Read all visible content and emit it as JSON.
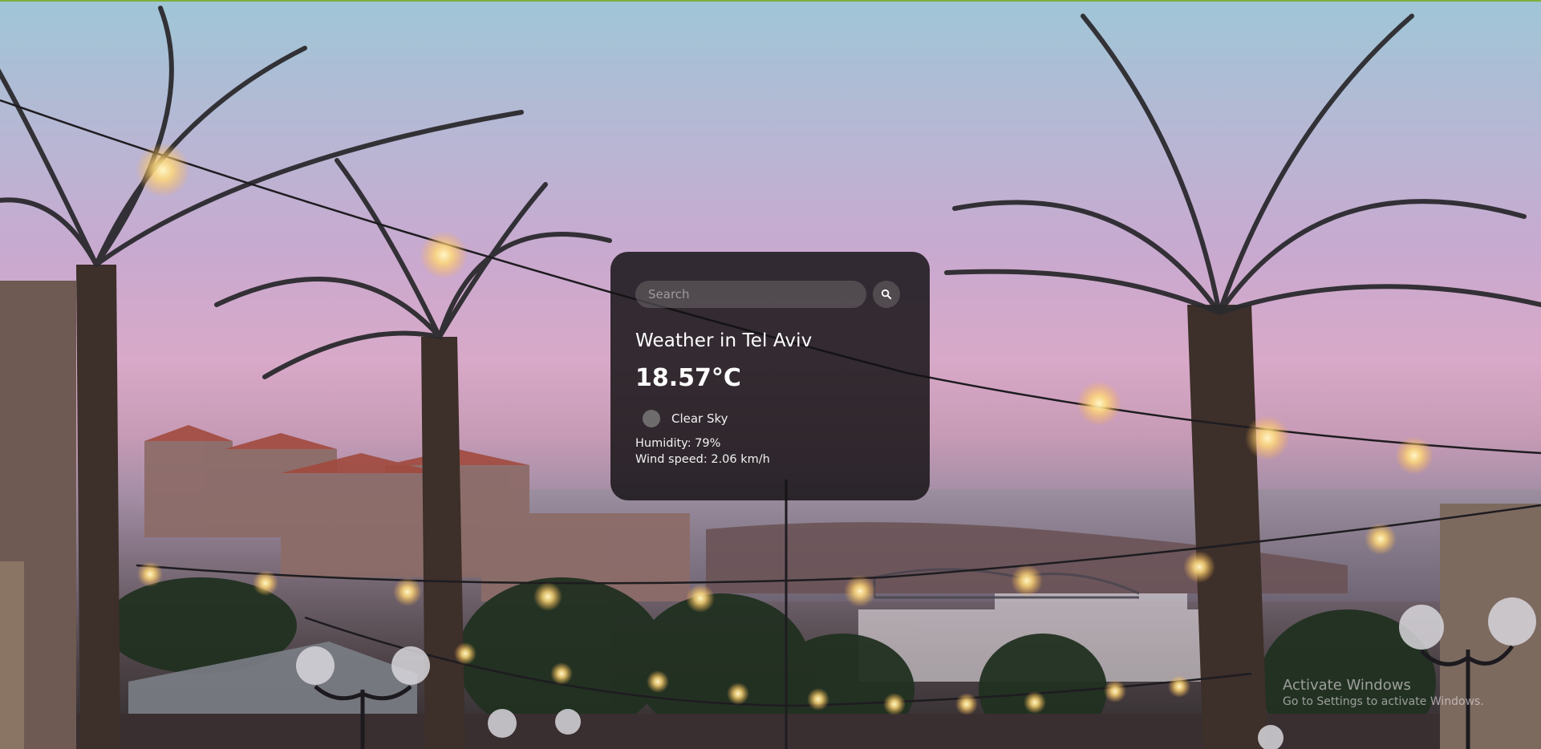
{
  "search": {
    "placeholder": "Search",
    "value": "",
    "button_icon": "search-icon"
  },
  "weather": {
    "title": "Weather in Tel Aviv",
    "temperature": "18.57°C",
    "icon": "weather-icon",
    "description": "Clear Sky",
    "humidity": "Humidity: 79%",
    "wind": "Wind speed: 2.06 km/h"
  },
  "watermark": {
    "title": "Activate Windows",
    "subtitle": "Go to Settings to activate Windows."
  },
  "colors": {
    "card_background": "#141214",
    "text": "#ffffff",
    "input_background": "#787376"
  }
}
